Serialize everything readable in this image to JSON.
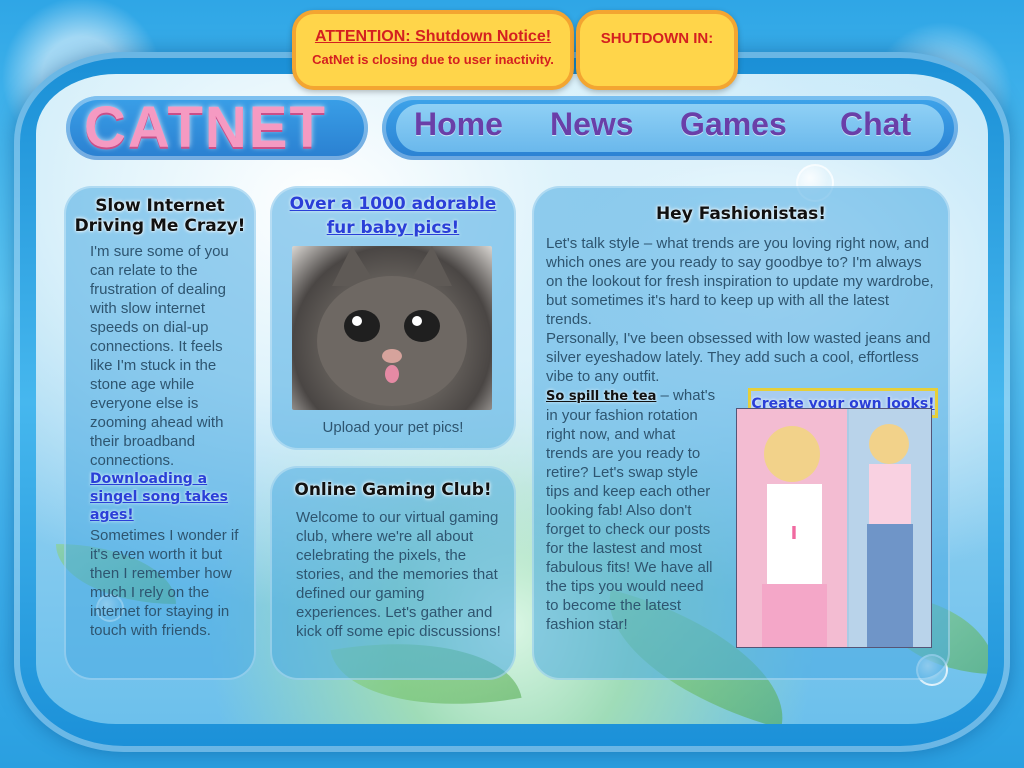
{
  "notice": {
    "title": "ATTENTION: Shutdown Notice!",
    "message": "CatNet is closing due to user inactivity.",
    "timer_label": "SHUTDOWN IN:"
  },
  "logo": "CATNET",
  "nav": [
    "Home",
    "News",
    "Games",
    "Chat"
  ],
  "panels": {
    "slow": {
      "title": "Slow Internet Driving Me Crazy!",
      "p1": "I'm sure some of you can relate to the frustration of dealing with slow internet speeds on dial-up connections. It feels like I'm stuck in the stone age while everyone else is zooming ahead with their broadband connections.",
      "link": "Downloading a singel song takes ages!",
      "p2": "Sometimes I wonder if it's even worth it but then I remember how much I rely on the internet for staying in touch with friends."
    },
    "pics": {
      "link": "Over a 1000 adorable fur baby pics!",
      "caption": "Upload your pet pics!"
    },
    "game": {
      "title": "Online Gaming Club!",
      "text": "Welcome to our virtual gaming club, where we're all about celebrating the pixels, the stories, and the memories that defined our gaming experiences. Let's gather and kick off some epic discussions!"
    },
    "fash": {
      "title": "Hey Fashionistas!",
      "p1": "Let's talk style – what trends are you loving right now, and which ones are you ready to say goodbye to? I'm always on the lookout for fresh inspiration to update my wardrobe, but sometimes it's hard to keep up with all the latest trends.",
      "p2": "Personally, I've been obsessed with low wasted jeans and silver eyeshadow lately. They add such a cool, effortless vibe to any outfit.",
      "bold": "So spill the tea",
      "p3": " – what's in your fashion rotation right now, and what trends are you ready to retire? Let's swap style tips and keep each other looking fab! Also don't forget to check our posts for the lastest and most fabulous fits! We have all the tips you would need to become the latest fashion star!",
      "button": "Create your own looks!"
    }
  }
}
